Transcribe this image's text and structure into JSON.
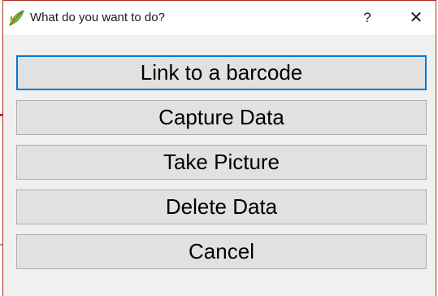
{
  "window": {
    "title": "What do you want to do?",
    "help_glyph": "?",
    "close_glyph": "✕",
    "icon": "app-leaf-icon"
  },
  "actions": [
    {
      "label": "Link to a barcode",
      "focused": true
    },
    {
      "label": "Capture Data",
      "focused": false
    },
    {
      "label": "Take Picture",
      "focused": false
    },
    {
      "label": "Delete Data",
      "focused": false
    },
    {
      "label": "Cancel",
      "focused": false
    }
  ],
  "colors": {
    "focus_border": "#0078d7",
    "button_face": "#e1e1e1",
    "dialog_border": "#b02a1e"
  }
}
